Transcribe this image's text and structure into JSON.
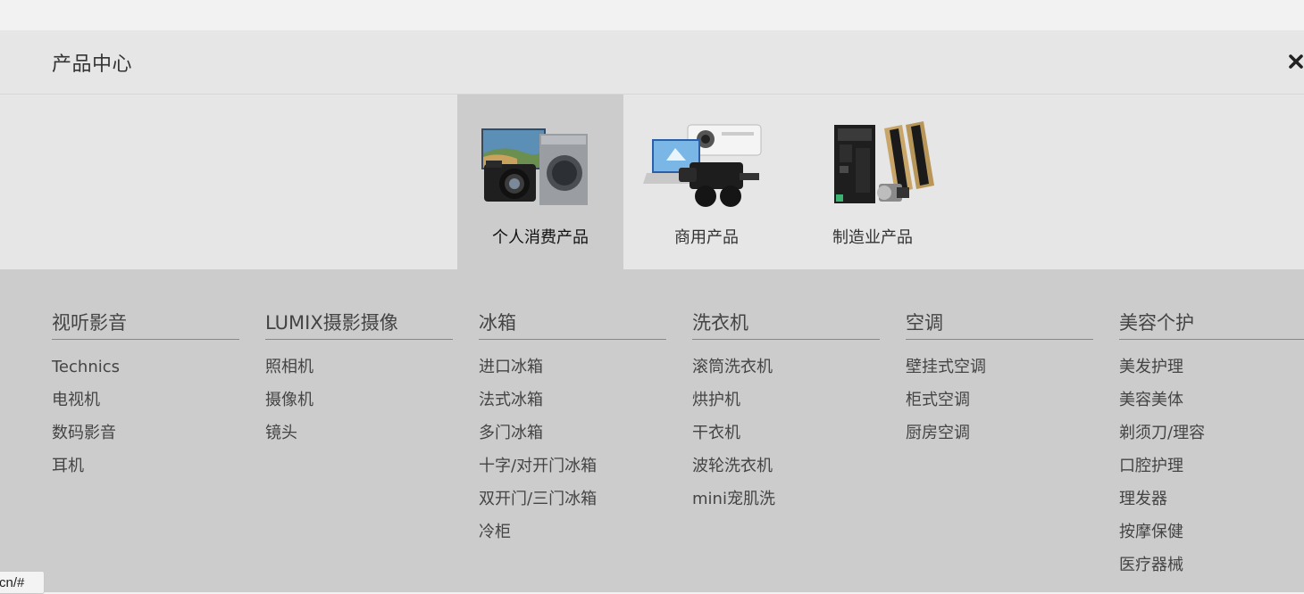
{
  "header": {
    "title": "产品中心",
    "close_icon": "close-icon"
  },
  "categories": [
    {
      "label": "个人消费产品",
      "active": true,
      "icon": "consumer-products-image"
    },
    {
      "label": "商用产品",
      "active": false,
      "icon": "business-products-image"
    },
    {
      "label": "制造业产品",
      "active": false,
      "icon": "manufacturing-products-image"
    }
  ],
  "columns": [
    {
      "title": "视听影音",
      "items": [
        "Technics",
        "电视机",
        "数码影音",
        "耳机"
      ]
    },
    {
      "title": "LUMIX摄影摄像",
      "items": [
        "照相机",
        "摄像机",
        "镜头"
      ]
    },
    {
      "title": "冰箱",
      "items": [
        "进口冰箱",
        "法式冰箱",
        "多门冰箱",
        "十字/对开门冰箱",
        "双开门/三门冰箱",
        "冷柜"
      ]
    },
    {
      "title": "洗衣机",
      "items": [
        "滚筒洗衣机",
        "烘护机",
        "干衣机",
        "波轮洗衣机",
        "mini宠肌洗"
      ]
    },
    {
      "title": "空调",
      "items": [
        "壁挂式空调",
        "柜式空调",
        "厨房空调"
      ]
    },
    {
      "title": "美容个护",
      "items": [
        "美发护理",
        "美容美体",
        "剃须刀/理容",
        "口腔护理",
        "理发器",
        "按摩保健",
        "医疗器械"
      ]
    }
  ],
  "status_bar": {
    "url_text": "cn/#"
  },
  "colors": {
    "header_bg": "#e6e6e6",
    "active_tab_bg": "#cccccc",
    "list_bg": "#cccccc",
    "text": "#444444"
  }
}
